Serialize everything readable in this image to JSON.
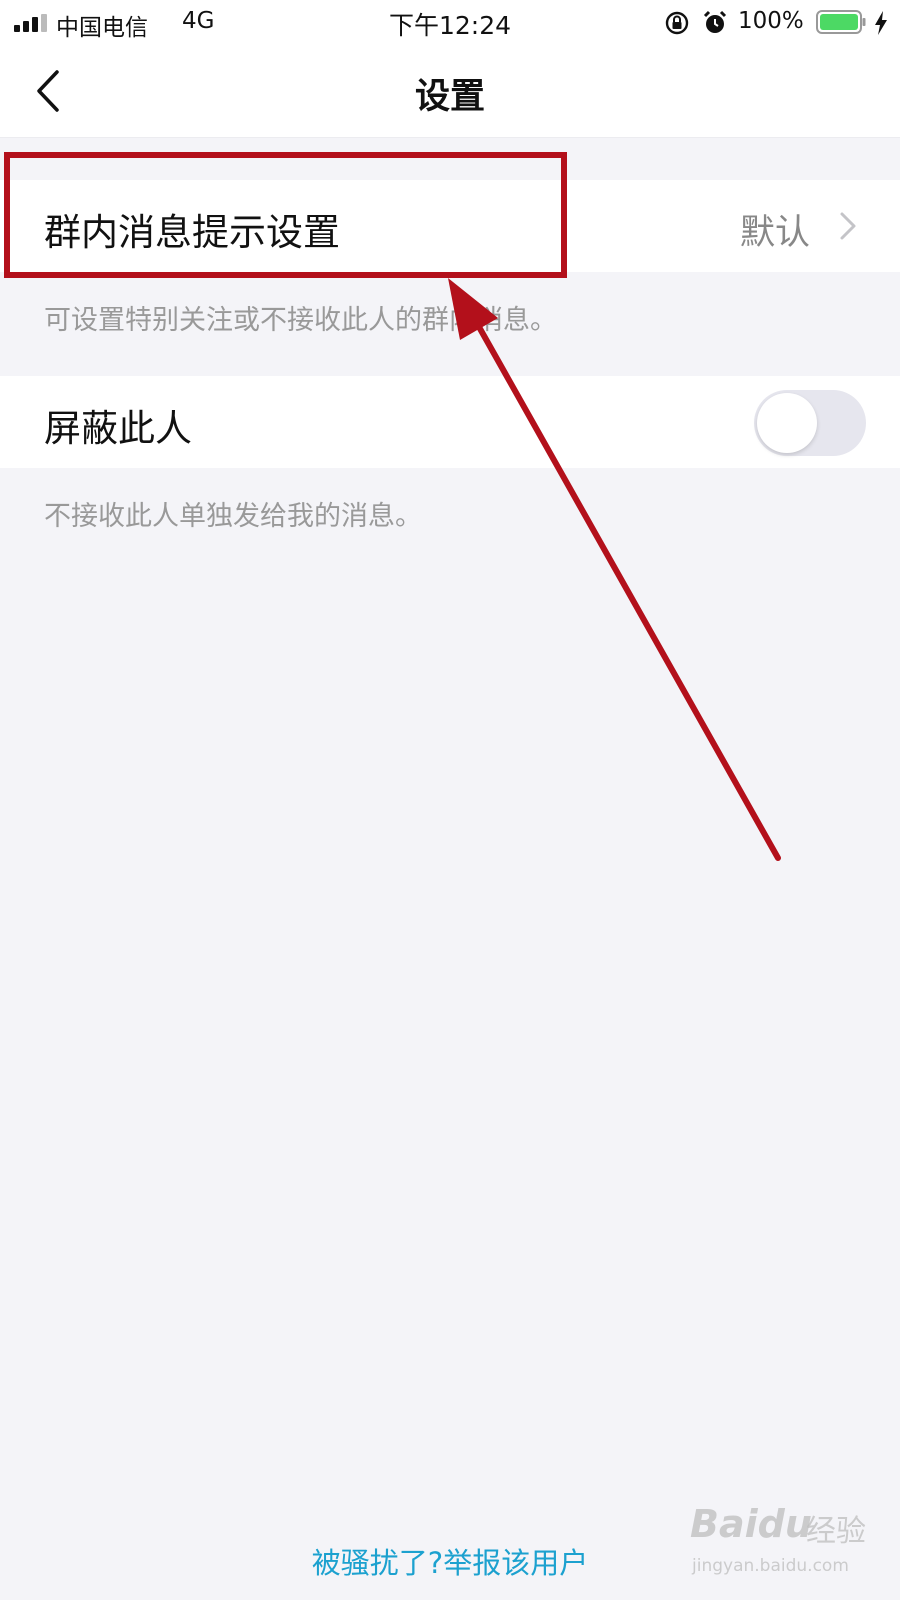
{
  "status_bar": {
    "carrier": "中国电信",
    "network": "4G",
    "time": "下午12:24",
    "battery_percent": "100%",
    "battery_level": 1.0,
    "battery_color": "#4cd964",
    "icons": [
      "signal-icon",
      "lock-rotation-icon",
      "alarm-icon",
      "battery-icon",
      "charging-bolt-icon"
    ]
  },
  "nav": {
    "title": "设置",
    "back_icon": "chevron-left-icon"
  },
  "settings": {
    "group_notify": {
      "label": "群内消息提示设置",
      "value": "默认",
      "hint": "可设置特别关注或不接收此人的群内消息。"
    },
    "block_user": {
      "label": "屏蔽此人",
      "enabled": false,
      "hint": "不接收此人单独发给我的消息。"
    }
  },
  "footer": {
    "report_link": "被骚扰了?举报该用户",
    "link_color": "#1ca1cf"
  },
  "annotation": {
    "color": "#b3101b"
  },
  "watermark": {
    "brand": "Baidu",
    "brand_cn": "经验",
    "url": "jingyan.baidu.com"
  }
}
